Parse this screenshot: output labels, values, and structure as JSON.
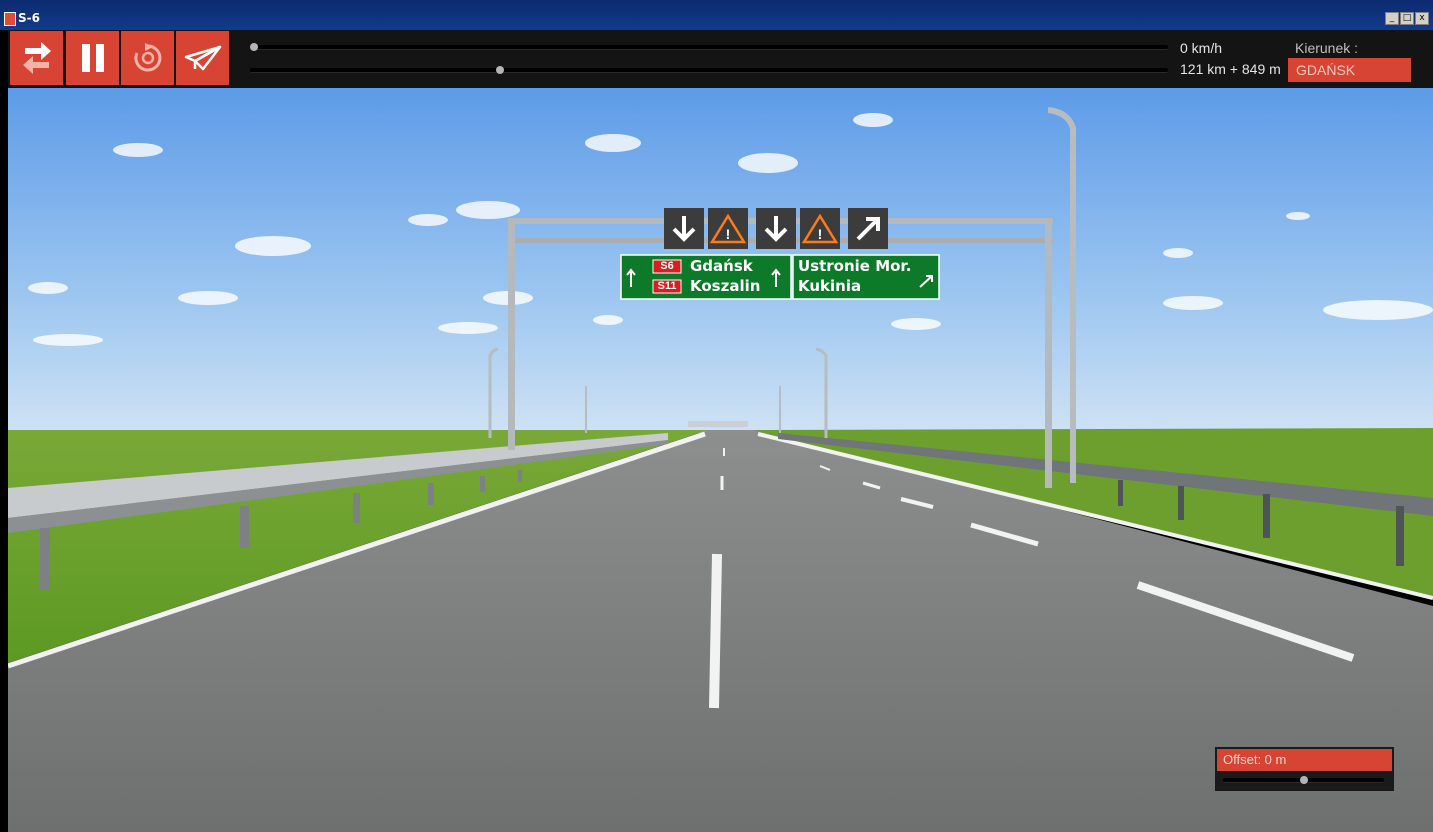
{
  "window": {
    "title": "S-6",
    "controls": [
      "_",
      "□",
      "x"
    ]
  },
  "toolbar": {
    "buttons": [
      {
        "name": "swap-direction-button",
        "icon": "swap-arrows-icon"
      },
      {
        "name": "pause-button",
        "icon": "pause-icon"
      },
      {
        "name": "restart-button",
        "icon": "restart-icon"
      },
      {
        "name": "send-button",
        "icon": "paper-plane-icon"
      }
    ],
    "accent_color": "#d84434",
    "speed_slider_level": 0.0,
    "position_slider_level": 0.27
  },
  "status": {
    "speed": "0 km/h",
    "position": "121 km + 849 m",
    "direction_label": "Kierunek :",
    "direction_value": "GDAŃSK"
  },
  "scene": {
    "gantry_symbols": [
      "down-arrow",
      "warning",
      "down-arrow",
      "warning",
      "diagonal-arrow"
    ],
    "sign_left": {
      "route1": "S6",
      "city1": "Gdańsk",
      "route2": "S11",
      "city2": "Koszalin"
    },
    "sign_right": {
      "city1": "Ustronie Mor.",
      "city2": "Kukinia"
    }
  },
  "offset": {
    "label": "Offset: 0 m",
    "slider_level": 0.5
  }
}
